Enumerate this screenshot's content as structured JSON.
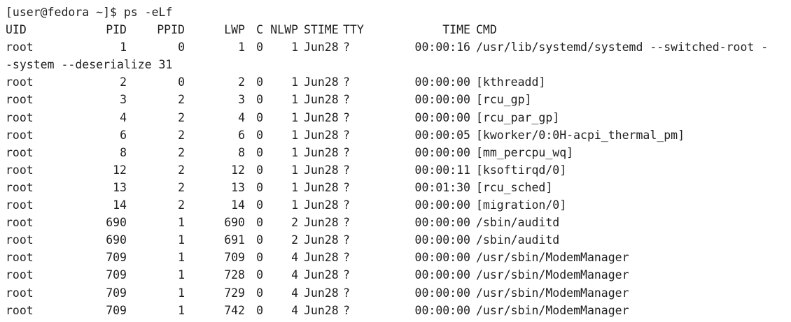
{
  "terminal": {
    "prompt": "[user@fedora ~]$ ps -eLf",
    "headers": {
      "uid": "UID",
      "pid": "PID",
      "ppid": "PPID",
      "lwp": "LWP",
      "c": "C",
      "nlwp": "NLWP",
      "stime": "STIME",
      "tty": "TTY",
      "time": "TIME",
      "cmd": "CMD"
    },
    "rows": [
      {
        "uid": "root",
        "pid": "1",
        "ppid": "0",
        "lwp": "1",
        "c": "0",
        "nlwp": "1",
        "stime": "Jun28",
        "tty": "?",
        "time": "00:00:16",
        "cmd": "/usr/lib/systemd/systemd --switched-root -"
      },
      {
        "uid": "root",
        "pid": "2",
        "ppid": "0",
        "lwp": "2",
        "c": "0",
        "nlwp": "1",
        "stime": "Jun28",
        "tty": "?",
        "time": "00:00:00",
        "cmd": "[kthreadd]"
      },
      {
        "uid": "root",
        "pid": "3",
        "ppid": "2",
        "lwp": "3",
        "c": "0",
        "nlwp": "1",
        "stime": "Jun28",
        "tty": "?",
        "time": "00:00:00",
        "cmd": "[rcu_gp]"
      },
      {
        "uid": "root",
        "pid": "4",
        "ppid": "2",
        "lwp": "4",
        "c": "0",
        "nlwp": "1",
        "stime": "Jun28",
        "tty": "?",
        "time": "00:00:00",
        "cmd": "[rcu_par_gp]"
      },
      {
        "uid": "root",
        "pid": "6",
        "ppid": "2",
        "lwp": "6",
        "c": "0",
        "nlwp": "1",
        "stime": "Jun28",
        "tty": "?",
        "time": "00:00:05",
        "cmd": "[kworker/0:0H-acpi_thermal_pm]"
      },
      {
        "uid": "root",
        "pid": "8",
        "ppid": "2",
        "lwp": "8",
        "c": "0",
        "nlwp": "1",
        "stime": "Jun28",
        "tty": "?",
        "time": "00:00:00",
        "cmd": "[mm_percpu_wq]"
      },
      {
        "uid": "root",
        "pid": "12",
        "ppid": "2",
        "lwp": "12",
        "c": "0",
        "nlwp": "1",
        "stime": "Jun28",
        "tty": "?",
        "time": "00:00:11",
        "cmd": "[ksoftirqd/0]"
      },
      {
        "uid": "root",
        "pid": "13",
        "ppid": "2",
        "lwp": "13",
        "c": "0",
        "nlwp": "1",
        "stime": "Jun28",
        "tty": "?",
        "time": "00:01:30",
        "cmd": "[rcu_sched]"
      },
      {
        "uid": "root",
        "pid": "14",
        "ppid": "2",
        "lwp": "14",
        "c": "0",
        "nlwp": "1",
        "stime": "Jun28",
        "tty": "?",
        "time": "00:00:00",
        "cmd": "[migration/0]"
      },
      {
        "uid": "root",
        "pid": "690",
        "ppid": "1",
        "lwp": "690",
        "c": "0",
        "nlwp": "2",
        "stime": "Jun28",
        "tty": "?",
        "time": "00:00:00",
        "cmd": "/sbin/auditd"
      },
      {
        "uid": "root",
        "pid": "690",
        "ppid": "1",
        "lwp": "691",
        "c": "0",
        "nlwp": "2",
        "stime": "Jun28",
        "tty": "?",
        "time": "00:00:00",
        "cmd": "/sbin/auditd"
      },
      {
        "uid": "root",
        "pid": "709",
        "ppid": "1",
        "lwp": "709",
        "c": "0",
        "nlwp": "4",
        "stime": "Jun28",
        "tty": "?",
        "time": "00:00:00",
        "cmd": "/usr/sbin/ModemManager"
      },
      {
        "uid": "root",
        "pid": "709",
        "ppid": "1",
        "lwp": "728",
        "c": "0",
        "nlwp": "4",
        "stime": "Jun28",
        "tty": "?",
        "time": "00:00:00",
        "cmd": "/usr/sbin/ModemManager"
      },
      {
        "uid": "root",
        "pid": "709",
        "ppid": "1",
        "lwp": "729",
        "c": "0",
        "nlwp": "4",
        "stime": "Jun28",
        "tty": "?",
        "time": "00:00:00",
        "cmd": "/usr/sbin/ModemManager"
      },
      {
        "uid": "root",
        "pid": "709",
        "ppid": "1",
        "lwp": "742",
        "c": "0",
        "nlwp": "4",
        "stime": "Jun28",
        "tty": "?",
        "time": "00:00:00",
        "cmd": "/usr/sbin/ModemManager"
      }
    ],
    "wrapped_continuation": "-system --deserialize 31",
    "colors": {
      "background": "#ffffff",
      "text": "#1f1f1f"
    }
  }
}
